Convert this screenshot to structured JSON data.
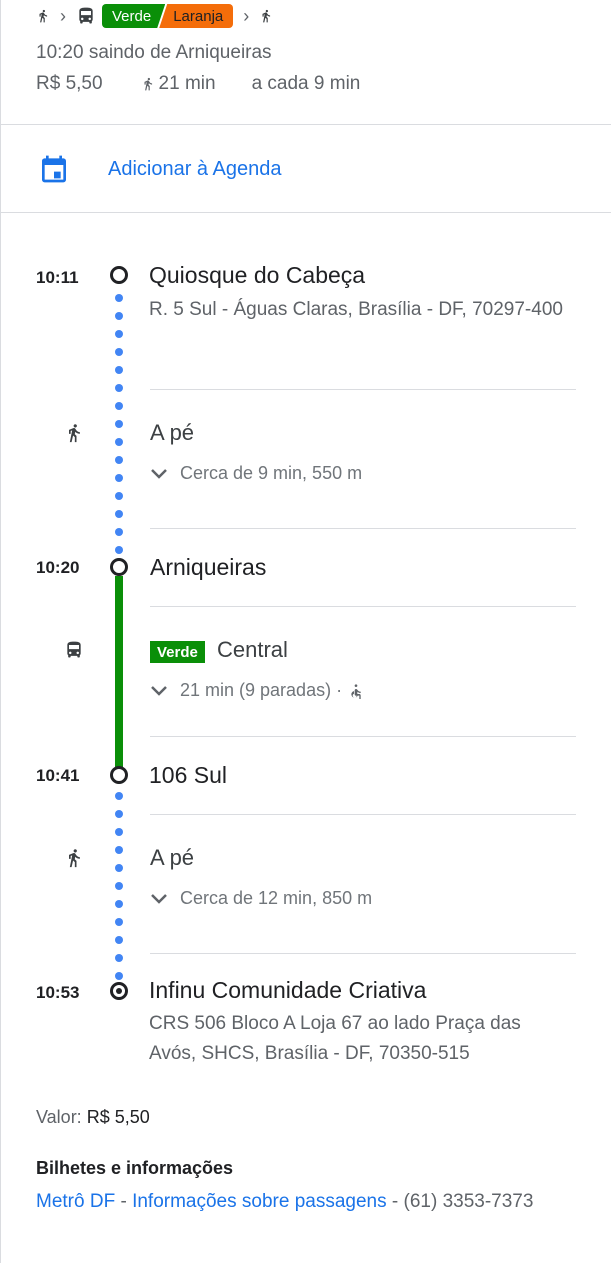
{
  "summary": {
    "route": {
      "line1": "Verde",
      "line2": "Laranja"
    },
    "departure": "10:20 saindo de Arniqueiras",
    "fare": "R$ 5,50",
    "walk": "21 min",
    "frequency": "a cada 9 min"
  },
  "calendar": {
    "label": "Adicionar à Agenda",
    "icon": "calendar-icon"
  },
  "colors": {
    "green": "#0a8f08",
    "orange": "#f46d0a",
    "link": "#1a73e8",
    "walkDots": "#4285f4"
  },
  "stops": [
    {
      "time": "10:11",
      "name": "Quiosque do Cabeça",
      "address": "R. 5 Sul - Águas Claras, Brasília - DF, 70297-400"
    },
    {
      "time": "10:20",
      "name": "Arniqueiras"
    },
    {
      "time": "10:41",
      "name": "106 Sul"
    },
    {
      "time": "10:53",
      "name": "Infinu Comunidade Criativa",
      "address": "CRS 506 Bloco A Loja 67 ao lado Praça das Avós, SHCS, Brasília - DF, 70350-515"
    }
  ],
  "segments": [
    {
      "mode": "walk",
      "title": "A pé",
      "detail": "Cerca de 9 min, 550 m"
    },
    {
      "mode": "bus",
      "badge": "Verde",
      "line": "Central",
      "detail": "21 min (9 paradas) ·"
    },
    {
      "mode": "walk",
      "title": "A pé",
      "detail": "Cerca de 12 min, 850 m"
    }
  ],
  "fare": {
    "label": "Valor:",
    "value": "R$ 5,50"
  },
  "info": {
    "title": "Bilhetes e informações",
    "link1": "Metrô DF",
    "sep1": " - ",
    "link2": "Informações sobre passagens",
    "sep2": " - ",
    "phone": "(61) 3353-7373"
  }
}
